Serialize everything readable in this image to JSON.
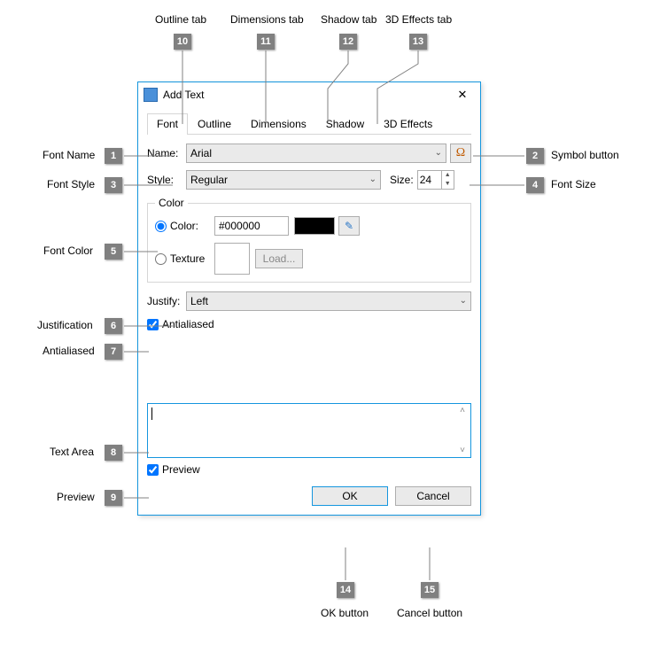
{
  "callouts": {
    "left": [
      {
        "num": "1",
        "label": "Font Name"
      },
      {
        "num": "3",
        "label": "Font Style"
      },
      {
        "num": "5",
        "label": "Font Color"
      },
      {
        "num": "6",
        "label": "Justification"
      },
      {
        "num": "7",
        "label": "Antialiased"
      },
      {
        "num": "8",
        "label": "Text Area"
      },
      {
        "num": "9",
        "label": "Preview"
      }
    ],
    "right": [
      {
        "num": "2",
        "label": "Symbol button"
      },
      {
        "num": "4",
        "label": "Font Size"
      }
    ],
    "top": [
      {
        "num": "10",
        "label": "Outline tab"
      },
      {
        "num": "11",
        "label": "Dimensions tab"
      },
      {
        "num": "12",
        "label": "Shadow tab"
      },
      {
        "num": "13",
        "label": "3D Effects tab"
      }
    ],
    "bottom": [
      {
        "num": "14",
        "label": "OK button"
      },
      {
        "num": "15",
        "label": "Cancel button"
      }
    ]
  },
  "dialog": {
    "title": "Add Text",
    "tabs": {
      "font": "Font",
      "outline": "Outline",
      "dimensions": "Dimensions",
      "shadow": "Shadow",
      "effects3d": "3D Effects"
    },
    "name_label": "Name:",
    "name_value": "Arial",
    "style_label": "Style:",
    "style_value": "Regular",
    "size_label": "Size:",
    "size_value": "24",
    "color_group_label": "Color",
    "color_radio_label": "Color:",
    "color_hex": "#000000",
    "texture_radio_label": "Texture",
    "load_button": "Load...",
    "justify_label": "Justify:",
    "justify_value": "Left",
    "antialiased_label": "Antialiased",
    "preview_label": "Preview",
    "ok": "OK",
    "cancel": "Cancel"
  }
}
